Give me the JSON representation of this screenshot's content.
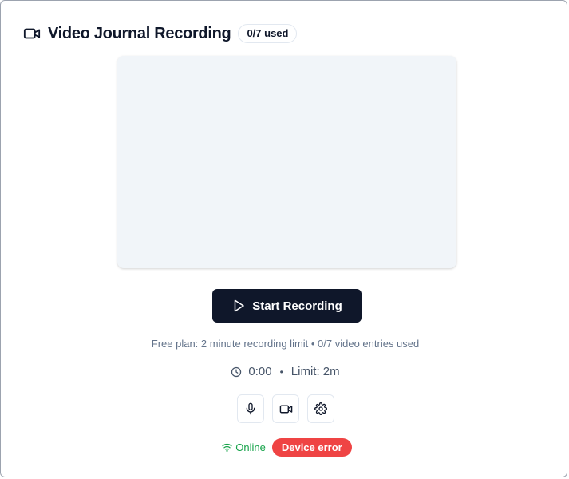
{
  "header": {
    "icon": "video-camera-icon",
    "title": "Video Journal Recording",
    "usage_badge": "0/7 used"
  },
  "recorder": {
    "start_label": "Start Recording",
    "start_icon": "play-icon",
    "plan_text": "Free plan: 2 minute recording limit • 0/7 video entries used",
    "timer": "0:00",
    "separator": "•",
    "limit": "Limit: 2m"
  },
  "controls": [
    {
      "name": "microphone-button",
      "icon": "microphone-icon"
    },
    {
      "name": "camera-button",
      "icon": "video-camera-icon"
    },
    {
      "name": "settings-button",
      "icon": "gear-icon"
    }
  ],
  "status": {
    "connection": "Online",
    "connection_icon": "wifi-icon",
    "error_badge": "Device error"
  },
  "colors": {
    "primary": "#0f172a",
    "preview_bg": "#f1f5f9",
    "online": "#16a34a",
    "error": "#ef4444",
    "muted": "#64748b"
  }
}
